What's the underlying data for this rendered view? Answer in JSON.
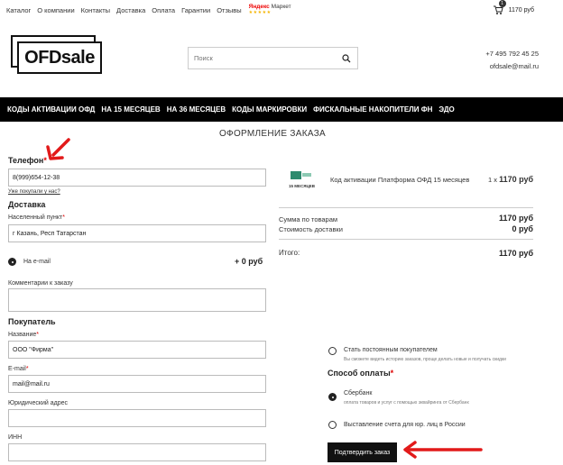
{
  "topnav": {
    "links": [
      "Каталог",
      "О компании",
      "Контакты",
      "Доставка",
      "Оплата",
      "Гарантии",
      "Отзывы"
    ],
    "market_badge": {
      "brand": "Яндекс",
      "name": "Маркет",
      "stars": "★★★★★"
    },
    "cart_count": "1",
    "cart_total": "1170 руб"
  },
  "header": {
    "logo_text": "OFDsale",
    "search_placeholder": "Поиск",
    "phone": "+7 495 792 45 25",
    "email": "ofdsale@mail.ru"
  },
  "categories": [
    "КОДЫ АКТИВАЦИИ ОФД",
    "НА 15 МЕСЯЦЕВ",
    "НА 36 МЕСЯЦЕВ",
    "КОДЫ МАРКИРОВКИ",
    "ФИСКАЛЬНЫЕ НАКОПИТЕЛИ ФН",
    "ЭДО"
  ],
  "page_title": "ОФОРМЛЕНИЕ ЗАКАЗА",
  "form": {
    "phone_label": "Телефон",
    "phone_value": "8(999)654-12-38",
    "already_bought_link": "Уже покупали у нас?",
    "delivery_heading": "Доставка",
    "city_label": "Населенный пункт",
    "city_value": "г Казань, Респ Татарстан",
    "delivery_option": "На e-mail",
    "delivery_price": "+ 0 руб",
    "comment_label": "Комментарии к заказу",
    "buyer_heading": "Покупатель",
    "name_label": "Название",
    "name_value": "ООО \"Фирма\"",
    "email_label": "E-mail",
    "email_value": "mail@mail.ru",
    "address_label": "Юридический адрес",
    "inn_label": "ИНН",
    "required_mark": "*"
  },
  "order": {
    "product_name": "Код активации Платформа ОФД 15 месяцев",
    "product_badge": "15 МЕСЯЦЕВ",
    "qty_prefix": "1 x",
    "product_price": "1170 руб",
    "sum_label": "Сумма по товарам",
    "sum_value": "1170 руб",
    "delivery_cost_label": "Стоимость доставки",
    "delivery_cost_value": "0 руб",
    "total_label": "Итого:",
    "total_value": "1170 руб"
  },
  "payment": {
    "regular_label": "Стать постоянным покупателем",
    "regular_hint": "Вы сможете видеть историю заказов, проще делать новые и получать скидки",
    "heading": "Способ оплаты",
    "option_sber": "Сбербанк",
    "option_sber_hint": "оплата товаров и услуг с помощью эквайринга от Сбербанк",
    "option_invoice": "Выставление счета для юр. лиц в России",
    "confirm_label": "Подтвердить заказ"
  },
  "colors": {
    "accent_arrow": "#e21a1a",
    "bar": "#000000"
  }
}
